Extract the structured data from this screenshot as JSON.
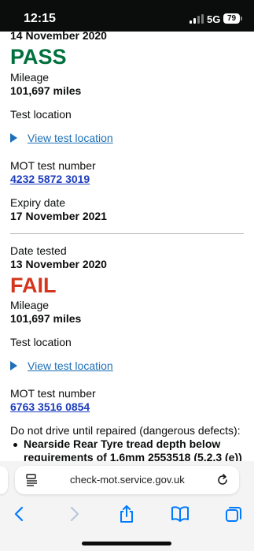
{
  "status_bar": {
    "time": "12:15",
    "network": "5G",
    "battery": "79"
  },
  "tests": [
    {
      "date": "14 November 2020",
      "result": "PASS",
      "mileage_label": "Mileage",
      "mileage": "101,697 miles",
      "location_label": "Test location",
      "location_link": "View test location",
      "mot_label": "MOT test number",
      "mot_number": "4232 5872 3019",
      "expiry_label": "Expiry date",
      "expiry_date": "17 November 2021"
    },
    {
      "date_label": "Date tested",
      "date": "13 November 2020",
      "result": "FAIL",
      "mileage_label": "Mileage",
      "mileage": "101,697 miles",
      "location_label": "Test location",
      "location_link": "View test location",
      "mot_label": "MOT test number",
      "mot_number": "6763 3516 0854",
      "defects_label": "Do not drive until repaired (dangerous defects):",
      "defects": [
        "Nearside Rear Tyre tread depth below",
        "requirements of 1.6mm 2553518 (5.2.3 (e))"
      ]
    }
  ],
  "browser": {
    "url": "check-mot.service.gov.uk"
  },
  "colors": {
    "pass": "#00703c",
    "fail": "#d4351c",
    "link": "#1d70b8",
    "accent_ios": "#007aff"
  },
  "icons": [
    "reader-icon",
    "reload-icon",
    "back-icon",
    "forward-icon",
    "share-icon",
    "bookmarks-icon",
    "tabs-icon"
  ]
}
